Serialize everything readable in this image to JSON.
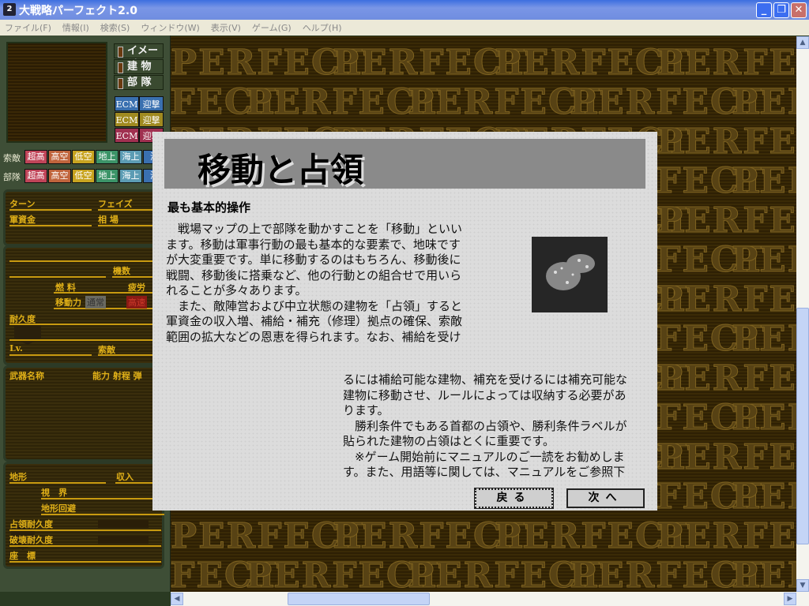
{
  "window": {
    "title": "大戦略パーフェクト2.0",
    "icon": "app-icon-2",
    "minimize": "_",
    "restore": "❐",
    "close": "✕"
  },
  "menu": [
    "ファイル(F)",
    "情報(I)",
    "検索(S)",
    "ウィンドウ(W)",
    "表示(V)",
    "ゲーム(G)",
    "ヘルプ(H)"
  ],
  "sidebar": {
    "view_buttons": [
      "イメージ",
      "建 物",
      "部 隊"
    ],
    "ecm_rows": [
      {
        "ecm": "ECM",
        "intercept": "迎撃",
        "color": "#3a70b0"
      },
      {
        "ecm": "ECM",
        "intercept": "迎撃",
        "color": "#a08a20"
      },
      {
        "ecm": "ECM",
        "intercept": "迎撃",
        "color": "#a03050"
      }
    ],
    "filter_rows": [
      {
        "label": "索敵"
      },
      {
        "label": "部隊"
      }
    ],
    "filters": [
      {
        "label": "超高",
        "color": "#c04458"
      },
      {
        "label": "高空",
        "color": "#c0643c"
      },
      {
        "label": "低空",
        "color": "#c8a420"
      },
      {
        "label": "地上",
        "color": "#3c9468"
      },
      {
        "label": "海上",
        "color": "#5c9cb4"
      },
      {
        "label": "海",
        "color": "#3a70b0"
      }
    ],
    "info": {
      "turn": "ターン",
      "phase": "フェイズ",
      "funds": "軍資金",
      "market": "相 場"
    },
    "unit": {
      "count": "機数",
      "fuel": "燃 料",
      "fatigue": "疲労",
      "move": "移動力",
      "normal": "通常",
      "fast": "高速",
      "durability": "耐久度",
      "lv": "Lv.",
      "search": "索敵"
    },
    "weapons": {
      "name": "武器名称",
      "cols": "能力 射程 弾"
    },
    "terrain": {
      "terrain": "地形",
      "income": "収入",
      "vision": "視　界",
      "evasion": "地形回避",
      "occupy": "占領耐久度",
      "destroy": "破壊耐久度",
      "coords": "座　標"
    }
  },
  "background_text": "PERFECT",
  "dialog": {
    "title": "移動と占領",
    "heading": "最も基本的操作",
    "text1": "　戦場マップの上で部隊を動かすことを「移動」といい\nます。移動は軍事行動の最も基本的な要素で、地味です\nが大変重要です。単に移動するのはもちろん、移動後に\n戦闘、移動後に搭乗など、他の行動との組合せで用いら\nれることが多々あります。\n　また、敵陣営および中立状態の建物を「占領」すると\n軍資金の収入増、補給・補充（修理）拠点の確保、索敵\n範囲の拡大などの恩恵を得られます。なお、補給を受け",
    "text2": "るには補給可能な建物、補充を受けるには補充可能な\n建物に移動させ、ルールによっては収納する必要があ\nります。\n　勝利条件でもある首都の占領や、勝利条件ラベルが\n貼られた建物の占領はとくに重要です。\n　※ゲーム開始前にマニュアルのご一読をお勧めしま\nす。また、用語等に関しては、マニュアルをご参照下",
    "back": "戻る",
    "next": "次へ"
  },
  "scroll": {
    "vertical_position": 0.49,
    "horizontal_position": 0.19
  }
}
